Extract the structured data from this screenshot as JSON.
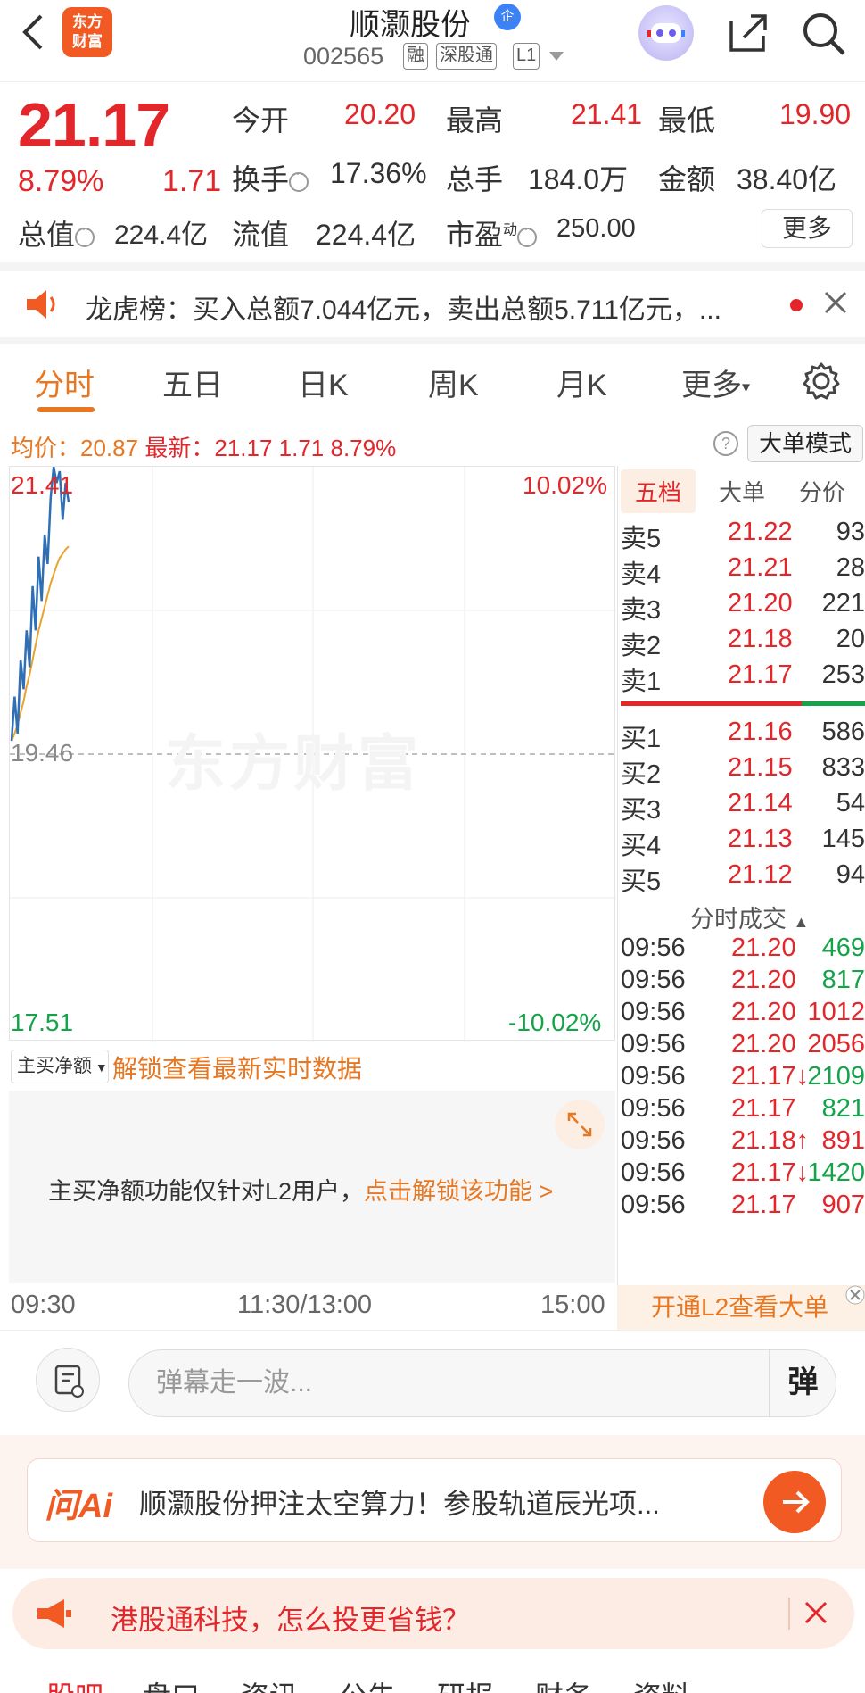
{
  "header": {
    "logo_line1": "东方",
    "logo_line2": "财富",
    "name": "顺灏股份",
    "verify_badge": "企",
    "code": "002565",
    "tags": [
      "融",
      "深股通",
      "L1"
    ]
  },
  "quote": {
    "price": "21.17",
    "change_pct": "8.79%",
    "change": "1.71",
    "open_label": "今开",
    "open": "20.20",
    "high_label": "最高",
    "high": "21.41",
    "low_label": "最低",
    "low": "19.90",
    "turnover_label": "换手",
    "turnover": "17.36%",
    "volume_label": "总手",
    "volume": "184.0万",
    "amount_label": "金额",
    "amount": "38.40亿",
    "mktcap_label": "总值",
    "mktcap": "224.4亿",
    "float_label": "流值",
    "float": "224.4亿",
    "pe_label": "市盈",
    "pe_sup": "动",
    "pe": "250.00",
    "more": "更多"
  },
  "news": {
    "text": "龙虎榜：买入总额7.044亿元，卖出总额5.711亿元，..."
  },
  "tabs": [
    "分时",
    "五日",
    "日K",
    "周K",
    "月K",
    "更多"
  ],
  "info": {
    "avg_label": "均价：",
    "avg": "20.87",
    "latest_label": "最新：",
    "latest": "21.17",
    "chg": "1.71",
    "pct": "8.79%",
    "help": "?",
    "bigorder_mode": "大单模式"
  },
  "chart": {
    "left_top": "21.41",
    "left_mid": "19.46",
    "left_bot": "17.51",
    "right_top": "10.02%",
    "right_bot": "-10.02%",
    "watermark": "东方财富",
    "times": [
      "09:30",
      "11:30/13:00",
      "15:00"
    ]
  },
  "chart_data": {
    "type": "line",
    "title": "",
    "ylim": [
      17.51,
      21.41
    ],
    "prev_close": 19.46,
    "series": [
      {
        "name": "",
        "color": "#2f6fb5",
        "values": [
          19.55,
          19.85,
          19.6,
          20.1,
          19.9,
          20.3,
          20.05,
          20.6,
          20.3,
          20.8,
          20.5,
          20.95,
          20.75,
          21.2,
          21.41,
          21.3,
          21.38,
          21.05,
          21.3,
          21.17
        ]
      },
      {
        "name": "",
        "color": "#e8a32e",
        "values": [
          19.55,
          19.6,
          19.66,
          19.74,
          19.82,
          19.92,
          20.0,
          20.1,
          20.2,
          20.3,
          20.38,
          20.46,
          20.54,
          20.62,
          20.68,
          20.74,
          20.79,
          20.82,
          20.85,
          20.87
        ]
      }
    ]
  },
  "book": {
    "tabs": [
      "五档",
      "大单",
      "分价"
    ],
    "asks": [
      {
        "label": "卖5",
        "price": "21.22",
        "vol": "93"
      },
      {
        "label": "卖4",
        "price": "21.21",
        "vol": "28"
      },
      {
        "label": "卖3",
        "price": "21.20",
        "vol": "221"
      },
      {
        "label": "卖2",
        "price": "21.18",
        "vol": "20"
      },
      {
        "label": "卖1",
        "price": "21.17",
        "vol": "253"
      }
    ],
    "bids": [
      {
        "label": "买1",
        "price": "21.16",
        "vol": "586"
      },
      {
        "label": "买2",
        "price": "21.15",
        "vol": "833"
      },
      {
        "label": "买3",
        "price": "21.14",
        "vol": "54"
      },
      {
        "label": "买4",
        "price": "21.13",
        "vol": "145"
      },
      {
        "label": "买5",
        "price": "21.12",
        "vol": "94"
      }
    ],
    "trades_title": "分时成交",
    "trades": [
      {
        "time": "09:56",
        "price": "21.20",
        "vol": "469",
        "color": "#15a34a"
      },
      {
        "time": "09:56",
        "price": "21.20",
        "vol": "817",
        "color": "#15a34a"
      },
      {
        "time": "09:56",
        "price": "21.20",
        "vol": "1012",
        "color": "#e2262a"
      },
      {
        "time": "09:56",
        "price": "21.20",
        "vol": "2056",
        "color": "#e2262a"
      },
      {
        "time": "09:56",
        "price": "21.17↓",
        "vol": "2109",
        "color": "#15a34a"
      },
      {
        "time": "09:56",
        "price": "21.17",
        "vol": "821",
        "color": "#15a34a"
      },
      {
        "time": "09:56",
        "price": "21.18↑",
        "vol": "891",
        "color": "#e2262a"
      },
      {
        "time": "09:56",
        "price": "21.17↓",
        "vol": "1420",
        "color": "#15a34a"
      },
      {
        "time": "09:56",
        "price": "21.17",
        "vol": "907",
        "color": "#e2262a"
      }
    ],
    "l2_button": "开通L2查看大单"
  },
  "flow": {
    "select": "主买净额",
    "unlock": "解锁查看最新实时数据",
    "msg": "主买净额功能仅针对L2用户，",
    "msg_link": "点击解锁该功能 >"
  },
  "danmaku": {
    "placeholder": "弹幕走一波...",
    "button": "弹"
  },
  "ai": {
    "logo": "问Ai",
    "text": "顺灏股份押注太空算力！参股轨道辰光项..."
  },
  "promo": {
    "text": "港股通科技，怎么投更省钱？"
  },
  "bottom_nav": [
    "股吧",
    "盘口",
    "资讯",
    "公告",
    "研报",
    "财务",
    "资料"
  ]
}
